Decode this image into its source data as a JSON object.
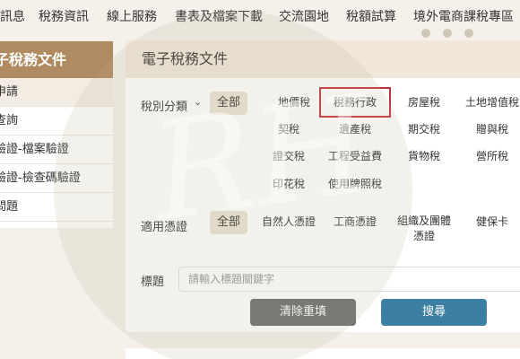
{
  "nav": {
    "items": [
      "訊息",
      "稅務資訊",
      "線上服務",
      "書表及檔案下載",
      "交流園地",
      "稅額試算",
      "境外電商課稅專區"
    ]
  },
  "sidebar": {
    "title": "子稅務文件",
    "items": [
      "申請",
      "查詢",
      "驗證-檔案驗證",
      "驗證-檢查碼驗證",
      "問題"
    ]
  },
  "panel": {
    "title": "電子稅務文件",
    "tax_type_label": "稅別分類",
    "tax_type_all": "全部",
    "tax_types": [
      "地價稅",
      "稅務行政",
      "房屋稅",
      "土地增值稅",
      "契稅",
      "遺產稅",
      "期交稅",
      "贈與稅",
      "證交稅",
      "工程受益費",
      "貨物稅",
      "營所稅",
      "印花稅",
      "使用牌照稅"
    ],
    "selected_tax_type": "稅務行政",
    "voucher_label": "適用憑證",
    "voucher_all": "全部",
    "vouchers": [
      "自然人憑證",
      "工商憑證",
      "組織及團體\n憑證",
      "健保卡"
    ],
    "keyword_label": "標題",
    "keyword_placeholder": "請輸入標題關鍵字",
    "clear_button": "清除重填",
    "search_button": "搜尋"
  },
  "watermark": "RH",
  "colors": {
    "sidebar_header": "#b08a60",
    "panel_header": "#f1e7d8",
    "selected_border": "#c0323a",
    "search_button": "#3c7fa3",
    "clear_button": "#6d6d6d"
  }
}
